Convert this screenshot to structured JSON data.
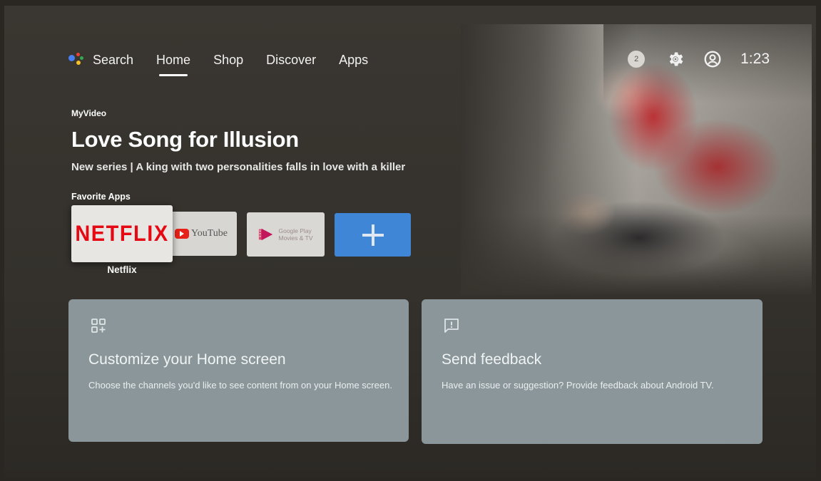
{
  "nav": {
    "search_label": "Search",
    "tabs": [
      {
        "label": "Home",
        "active": true
      },
      {
        "label": "Shop",
        "active": false
      },
      {
        "label": "Discover",
        "active": false
      },
      {
        "label": "Apps",
        "active": false
      }
    ]
  },
  "status": {
    "notification_count": "2",
    "time": "1:23"
  },
  "hero": {
    "provider": "MyVideo",
    "title": "Love Song for Illusion",
    "subtitle": "New series | A king with two personalities falls in love with a killer"
  },
  "favorite_apps": {
    "label": "Favorite Apps",
    "apps": [
      {
        "name": "Netflix",
        "logo_text": "NETFLIX"
      },
      {
        "name": "YouTube",
        "logo_text": "YouTube"
      },
      {
        "name": "Google Play Movies & TV",
        "logo_line1": "Google Play",
        "logo_line2": "Movies & TV"
      }
    ],
    "focused_caption": "Netflix"
  },
  "cards": [
    {
      "icon": "customize-grid-icon",
      "title": "Customize your Home screen",
      "description": "Choose the channels you'd like to see content from on your Home screen."
    },
    {
      "icon": "feedback-icon",
      "title": "Send feedback",
      "description": "Have an issue or suggestion? Provide feedback about Android TV."
    }
  ],
  "colors": {
    "accent_blue": "#3f87d6",
    "netflix_red": "#e50914",
    "card_bg": "#8a9699"
  }
}
